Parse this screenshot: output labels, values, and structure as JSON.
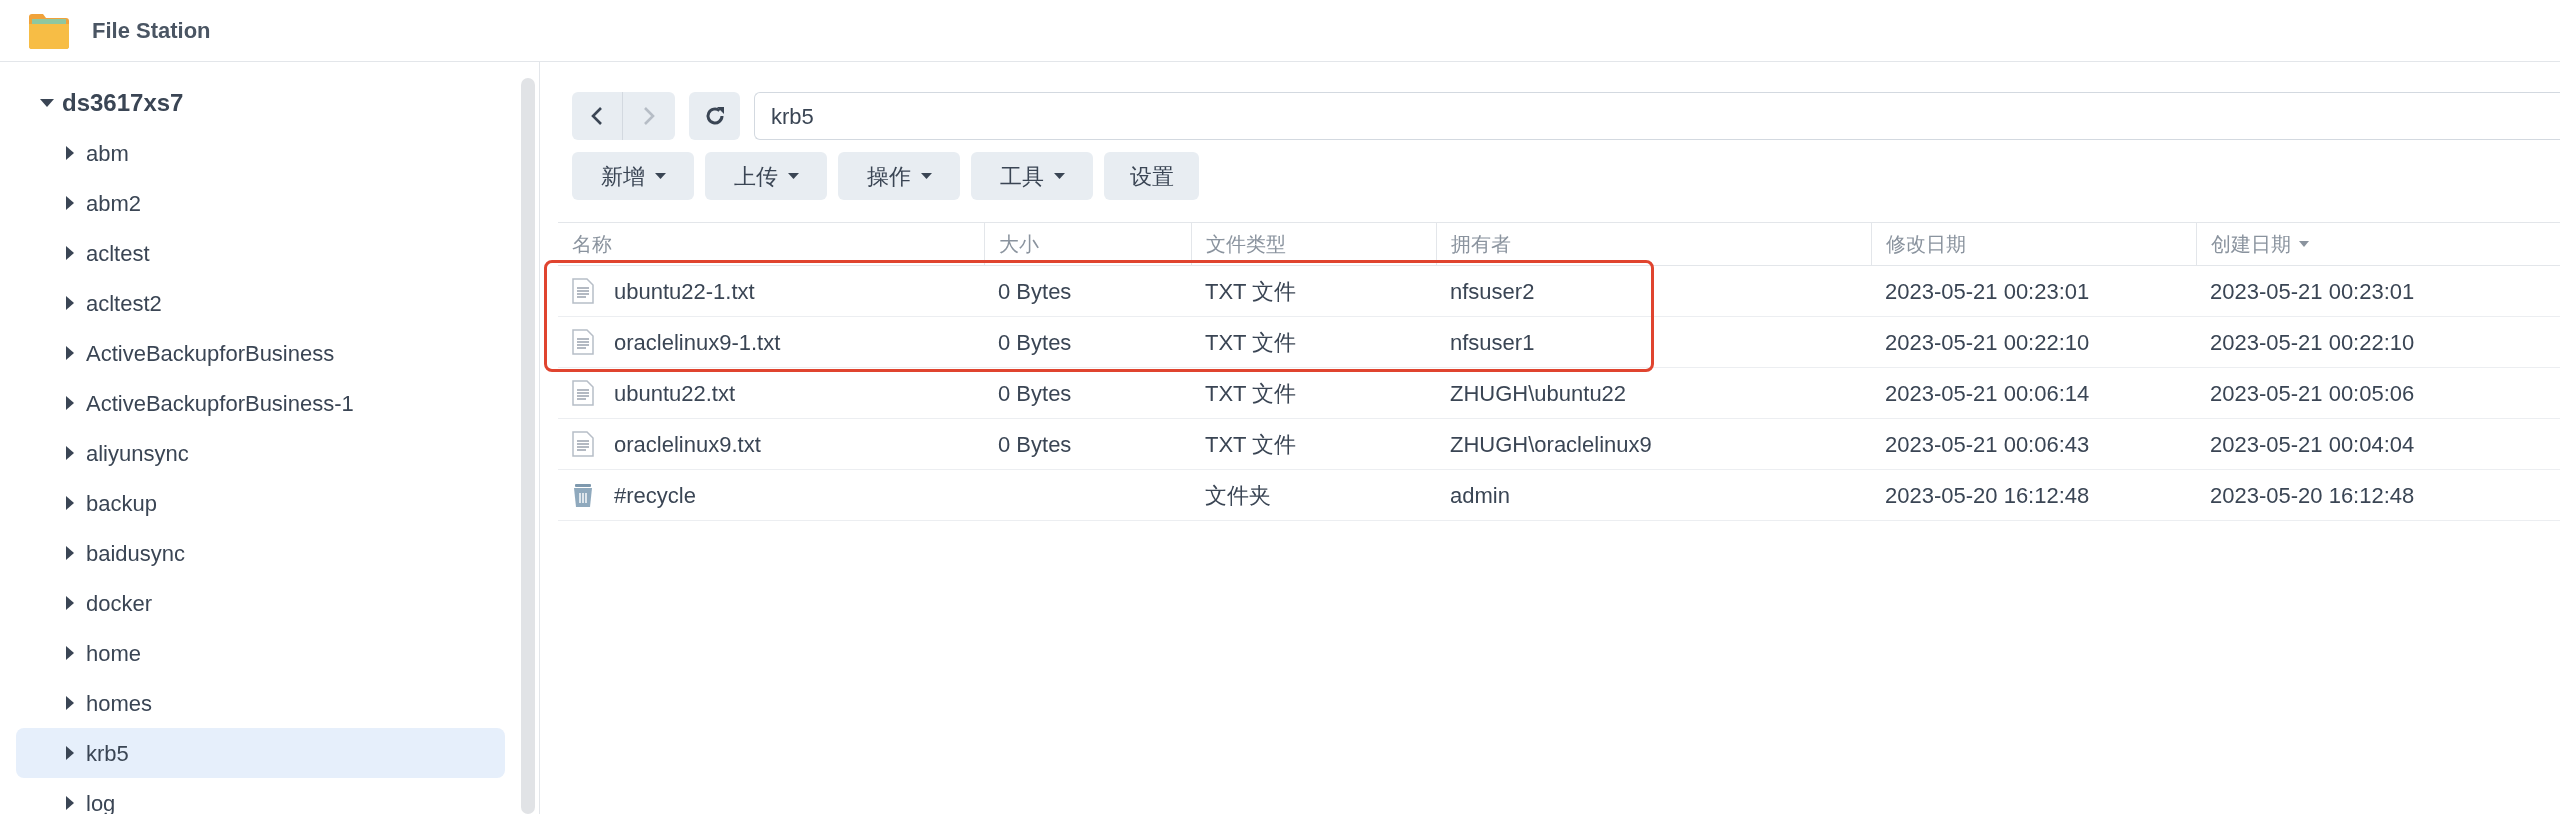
{
  "app": {
    "title": "File Station"
  },
  "tree": {
    "label": "ds3617xs7",
    "expanded": true,
    "selected": false,
    "children": [
      {
        "label": "abm",
        "expanded": false,
        "selected": false
      },
      {
        "label": "abm2",
        "expanded": false,
        "selected": false
      },
      {
        "label": "acltest",
        "expanded": false,
        "selected": false
      },
      {
        "label": "acltest2",
        "expanded": false,
        "selected": false
      },
      {
        "label": "ActiveBackupforBusiness",
        "expanded": false,
        "selected": false
      },
      {
        "label": "ActiveBackupforBusiness-1",
        "expanded": false,
        "selected": false
      },
      {
        "label": "aliyunsync",
        "expanded": false,
        "selected": false
      },
      {
        "label": "backup",
        "expanded": false,
        "selected": false
      },
      {
        "label": "baidusync",
        "expanded": false,
        "selected": false
      },
      {
        "label": "docker",
        "expanded": false,
        "selected": false
      },
      {
        "label": "home",
        "expanded": false,
        "selected": false
      },
      {
        "label": "homes",
        "expanded": false,
        "selected": false
      },
      {
        "label": "krb5",
        "expanded": false,
        "selected": true
      },
      {
        "label": "log",
        "expanded": false,
        "selected": false
      }
    ]
  },
  "path": "krb5",
  "toolbar": [
    {
      "label": "新增",
      "dropdown": true
    },
    {
      "label": "上传",
      "dropdown": true
    },
    {
      "label": "操作",
      "dropdown": true
    },
    {
      "label": "工具",
      "dropdown": true
    },
    {
      "label": "设置",
      "dropdown": false
    }
  ],
  "table": {
    "columns": [
      {
        "label": "名称",
        "sorted": false
      },
      {
        "label": "大小",
        "sorted": false
      },
      {
        "label": "文件类型",
        "sorted": false
      },
      {
        "label": "拥有者",
        "sorted": false
      },
      {
        "label": "修改日期",
        "sorted": false
      },
      {
        "label": "创建日期",
        "sorted": true
      }
    ],
    "rows": [
      {
        "kind": "file",
        "highlighted": true,
        "cells": [
          "ubuntu22-1.txt",
          "0 Bytes",
          "TXT 文件",
          "nfsuser2",
          "2023-05-21 00:23:01",
          "2023-05-21 00:23:01"
        ]
      },
      {
        "kind": "file",
        "highlighted": true,
        "cells": [
          "oraclelinux9-1.txt",
          "0 Bytes",
          "TXT 文件",
          "nfsuser1",
          "2023-05-21 00:22:10",
          "2023-05-21 00:22:10"
        ]
      },
      {
        "kind": "file",
        "highlighted": false,
        "cells": [
          "ubuntu22.txt",
          "0 Bytes",
          "TXT 文件",
          "ZHUGH\\ubuntu22",
          "2023-05-21 00:06:14",
          "2023-05-21 00:05:06"
        ]
      },
      {
        "kind": "file",
        "highlighted": false,
        "cells": [
          "oraclelinux9.txt",
          "0 Bytes",
          "TXT 文件",
          "ZHUGH\\oraclelinux9",
          "2023-05-21 00:06:43",
          "2023-05-21 00:04:04"
        ]
      },
      {
        "kind": "recycle",
        "highlighted": false,
        "cells": [
          "#recycle",
          null,
          "文件夹",
          "admin",
          "2023-05-20 16:12:48",
          "2023-05-20 16:12:48"
        ]
      }
    ]
  }
}
